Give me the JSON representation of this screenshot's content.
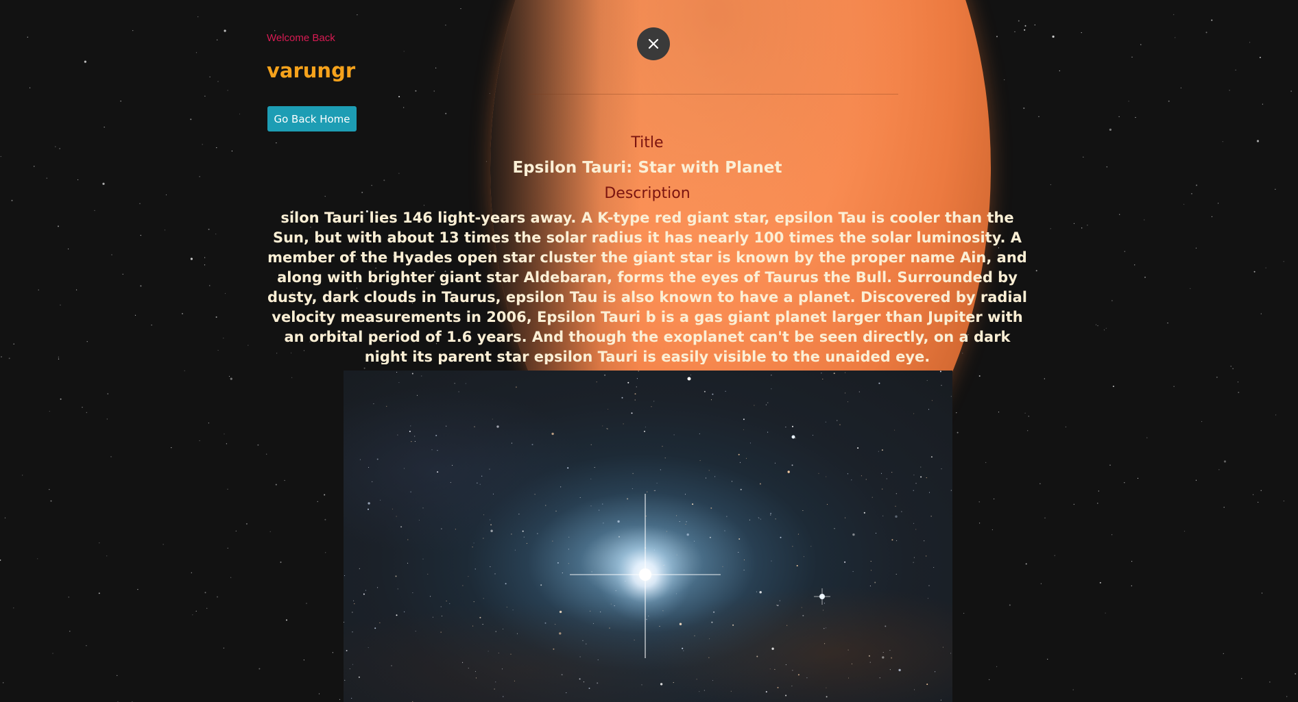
{
  "header": {
    "welcome_text": "Welcome Back",
    "username": "varungr",
    "home_button_label": "Go Back Home"
  },
  "modal": {
    "close_icon": "close-icon",
    "title_heading": "Title",
    "title": "Epsilon Tauri: Star with Planet",
    "description_heading": "Description",
    "description": "silon Tauri lies 146 light-years away. A K-type red giant star, epsilon Tau is cooler than the Sun, but with about 13 times the solar radius it has nearly 100 times the solar luminosity. A member of the Hyades open star cluster the giant star is known by the proper name Ain, and along with brighter giant star Aldebaran, forms the eyes of Taurus the Bull. Surrounded by dusty, dark clouds in Taurus, epsilon Tau is also known to have a planet. Discovered by radial velocity measurements in 2006, Epsilon Tauri b is a gas giant planet larger than Jupiter with an orbital period of 1.6 years. And though the exoplanet can't be seen directly, on a dark night its parent star epsilon Tauri is easily visible to the unaided eye."
  },
  "colors": {
    "welcome": "#d81b53",
    "username": "#f5a21c",
    "button": "#1d9db4",
    "section_heading": "#7a1410",
    "body_text": "#fbefd5",
    "planet": "#f98c52"
  }
}
